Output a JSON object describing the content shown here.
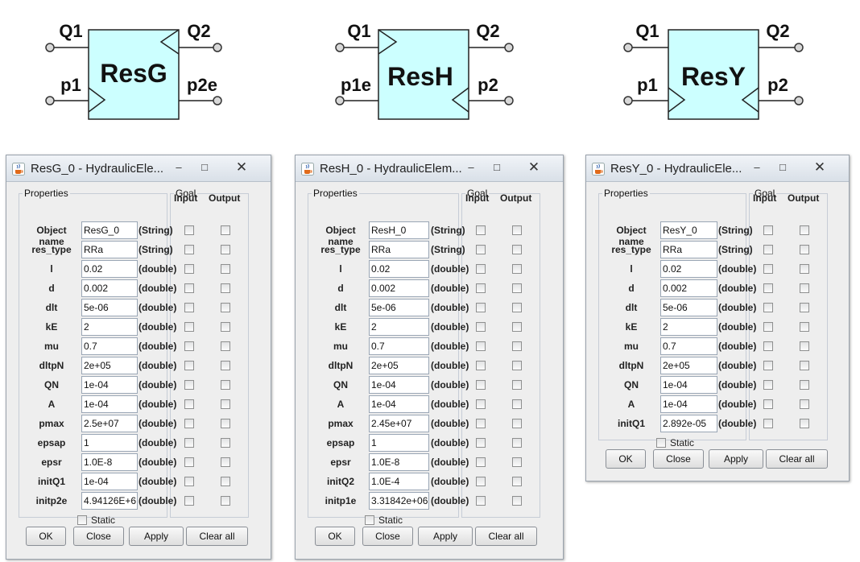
{
  "blocks": [
    {
      "name": "ResG",
      "top_left": "Q1",
      "top_right": "Q2",
      "bottom_left": "p1",
      "bottom_right": "p2e"
    },
    {
      "name": "ResH",
      "top_left": "Q1",
      "top_right": "Q2",
      "bottom_left": "p1e",
      "bottom_right": "p2"
    },
    {
      "name": "ResY",
      "top_left": "Q1",
      "top_right": "Q2",
      "bottom_left": "p1",
      "bottom_right": "p2"
    }
  ],
  "dialogs": [
    {
      "title": "ResG_0 - HydraulicEle...",
      "properties_legend": "Properties",
      "goal_legend": "Goal",
      "input_header": "Input",
      "output_header": "Output",
      "rows": [
        {
          "label": "Object name",
          "value": "ResG_0",
          "type": "(String)"
        },
        {
          "label": "res_type",
          "value": "RRa",
          "type": "(String)"
        },
        {
          "label": "l",
          "value": "0.02",
          "type": "(double)"
        },
        {
          "label": "d",
          "value": "0.002",
          "type": "(double)"
        },
        {
          "label": "dlt",
          "value": "5e-06",
          "type": "(double)"
        },
        {
          "label": "kE",
          "value": "2",
          "type": "(double)"
        },
        {
          "label": "mu",
          "value": "0.7",
          "type": "(double)"
        },
        {
          "label": "dltpN",
          "value": "2e+05",
          "type": "(double)"
        },
        {
          "label": "QN",
          "value": "1e-04",
          "type": "(double)"
        },
        {
          "label": "A",
          "value": "1e-04",
          "type": "(double)"
        },
        {
          "label": "pmax",
          "value": "2.5e+07",
          "type": "(double)"
        },
        {
          "label": "epsap",
          "value": "1",
          "type": "(double)"
        },
        {
          "label": "epsr",
          "value": "1.0E-8",
          "type": "(double)"
        },
        {
          "label": "initQ1",
          "value": "1e-04",
          "type": "(double)"
        },
        {
          "label": "initp2e",
          "value": "4.94126E+6",
          "type": "(double)"
        }
      ],
      "static_label": "Static",
      "buttons": {
        "ok": "OK",
        "close": "Close",
        "apply": "Apply",
        "clear": "Clear all"
      }
    },
    {
      "title": "ResH_0 - HydraulicElem...",
      "properties_legend": "Properties",
      "goal_legend": "Goal",
      "input_header": "Input",
      "output_header": "Output",
      "rows": [
        {
          "label": "Object name",
          "value": "ResH_0",
          "type": "(String)"
        },
        {
          "label": "res_type",
          "value": "RRa",
          "type": "(String)"
        },
        {
          "label": "l",
          "value": "0.02",
          "type": "(double)"
        },
        {
          "label": "d",
          "value": "0.002",
          "type": "(double)"
        },
        {
          "label": "dlt",
          "value": "5e-06",
          "type": "(double)"
        },
        {
          "label": "kE",
          "value": "2",
          "type": "(double)"
        },
        {
          "label": "mu",
          "value": "0.7",
          "type": "(double)"
        },
        {
          "label": "dltpN",
          "value": "2e+05",
          "type": "(double)"
        },
        {
          "label": "QN",
          "value": "1e-04",
          "type": "(double)"
        },
        {
          "label": "A",
          "value": "1e-04",
          "type": "(double)"
        },
        {
          "label": "pmax",
          "value": "2.45e+07",
          "type": "(double)"
        },
        {
          "label": "epsap",
          "value": "1",
          "type": "(double)"
        },
        {
          "label": "epsr",
          "value": "1.0E-8",
          "type": "(double)"
        },
        {
          "label": "initQ2",
          "value": "1.0E-4",
          "type": "(double)"
        },
        {
          "label": "initp1e",
          "value": "3.31842e+06",
          "type": "(double)"
        }
      ],
      "static_label": "Static",
      "buttons": {
        "ok": "OK",
        "close": "Close",
        "apply": "Apply",
        "clear": "Clear all"
      }
    },
    {
      "title": "ResY_0 - HydraulicEle...",
      "properties_legend": "Properties",
      "goal_legend": "Goal",
      "input_header": "Input",
      "output_header": "Output",
      "rows": [
        {
          "label": "Object name",
          "value": "ResY_0",
          "type": "(String)"
        },
        {
          "label": "res_type",
          "value": "RRa",
          "type": "(String)"
        },
        {
          "label": "l",
          "value": "0.02",
          "type": "(double)"
        },
        {
          "label": "d",
          "value": "0.002",
          "type": "(double)"
        },
        {
          "label": "dlt",
          "value": "5e-06",
          "type": "(double)"
        },
        {
          "label": "kE",
          "value": "2",
          "type": "(double)"
        },
        {
          "label": "mu",
          "value": "0.7",
          "type": "(double)"
        },
        {
          "label": "dltpN",
          "value": "2e+05",
          "type": "(double)"
        },
        {
          "label": "QN",
          "value": "1e-04",
          "type": "(double)"
        },
        {
          "label": "A",
          "value": "1e-04",
          "type": "(double)"
        },
        {
          "label": "initQ1",
          "value": "2.892e-05",
          "type": "(double)"
        }
      ],
      "static_label": "Static",
      "buttons": {
        "ok": "OK",
        "close": "Close",
        "apply": "Apply",
        "clear": "Clear all"
      }
    }
  ]
}
